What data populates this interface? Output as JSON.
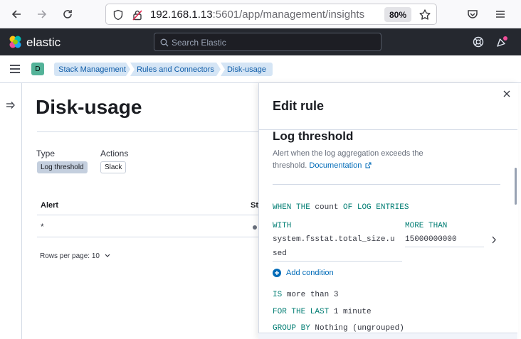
{
  "browser": {
    "url_host": "192.168.1.13",
    "url_rest": ":5601/app/management/insights",
    "zoom": "80%"
  },
  "header": {
    "wordmark": "elastic",
    "search_placeholder": "Search Elastic"
  },
  "breadcrumb": {
    "space_initial": "D",
    "items": [
      "Stack Management",
      "Rules and Connectors",
      "Disk-usage"
    ]
  },
  "page": {
    "title": "Disk-usage",
    "type_label": "Type",
    "type_value": "Log threshold",
    "actions_label": "Actions",
    "actions_value": "Slack",
    "table": {
      "headers": [
        "Alert",
        "Sta"
      ],
      "row_alert": "*"
    },
    "rows_per_page": "Rows per page: 10"
  },
  "flyout": {
    "title": "Edit rule",
    "rule_name": "Log threshold",
    "description": "Alert when the log aggregation exceeds the threshold.",
    "doc_link": "Documentation",
    "when": {
      "kw1": "WHEN THE",
      "val1": "count",
      "kw2": "OF LOG ENTRIES"
    },
    "with_label": "WITH",
    "field_line1": "system.fsstat.total_size.u",
    "field_line2": "sed",
    "more_than_label": "MORE THAN",
    "more_than_value": "15000000000",
    "add_condition": "Add condition",
    "is": {
      "kw": "IS",
      "val": "more than 3"
    },
    "for_last": {
      "kw": "FOR THE LAST",
      "val": "1 minute"
    },
    "group_by": {
      "kw": "GROUP BY",
      "val": "Nothing (ungrouped)"
    }
  },
  "colors": {
    "header_bg": "#25282f",
    "link": "#006bb8",
    "keyword": "#017d73",
    "crumb_bg": "#d5e5f5"
  }
}
